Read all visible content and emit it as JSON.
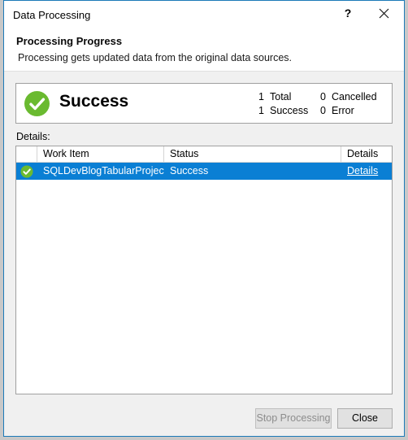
{
  "window": {
    "title": "Data Processing",
    "help_icon": "question-mark-icon",
    "help_label": "?",
    "close_icon": "close-icon"
  },
  "header": {
    "title": "Processing Progress",
    "subtitle": "Processing gets updated data from the original data sources."
  },
  "status_panel": {
    "icon": "success-check-icon",
    "label": "Success",
    "accent_color": "#6aba30",
    "counters": [
      {
        "value": "1",
        "label": "Total"
      },
      {
        "value": "0",
        "label": "Cancelled"
      },
      {
        "value": "1",
        "label": "Success"
      },
      {
        "value": "0",
        "label": "Error"
      }
    ]
  },
  "details": {
    "label": "Details:",
    "columns": [
      "",
      "Work Item",
      "Status",
      "Details"
    ],
    "rows": [
      {
        "icon": "success-check-icon",
        "work_item": "SQLDevBlogTabularProject",
        "status": "Success",
        "details_link": "Details",
        "selected": true,
        "selection_color": "#0a7fd4"
      }
    ]
  },
  "footer": {
    "stop_label": "Stop Processing",
    "stop_disabled": true,
    "close_label": "Close"
  }
}
